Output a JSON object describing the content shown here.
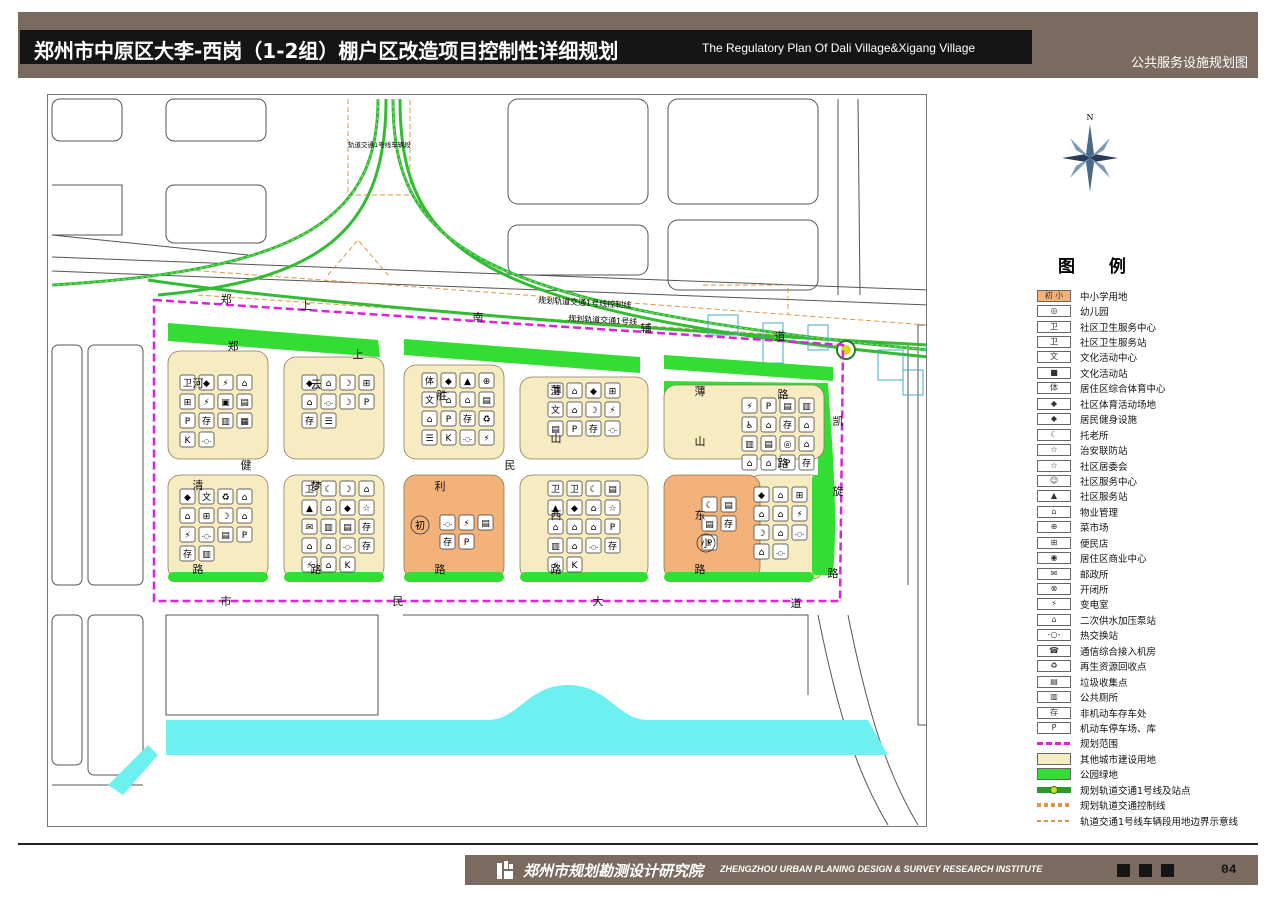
{
  "header": {
    "title_cn": "郑州市中原区大李-西岗（1-2组）棚户区改造项目控制性详细规划",
    "title_en": "The Regulatory Plan Of Dali Village&Xigang Village",
    "sheet_name": "公共服务设施规划图"
  },
  "compass": {
    "north_label": "N"
  },
  "map": {
    "rail_labels": {
      "depot": "轨道交通1号线车辆段",
      "control_line": "规划轨道交通1号线控制线",
      "line": "规划轨道交通1号线"
    },
    "road_labels": [
      {
        "text": "郑"
      },
      {
        "text": "上"
      },
      {
        "text": "南"
      },
      {
        "text": "辅"
      },
      {
        "text": "道"
      },
      {
        "text": "郑"
      },
      {
        "text": "上"
      },
      {
        "text": "路"
      },
      {
        "text": "河"
      },
      {
        "text": "云"
      },
      {
        "text": "胜"
      },
      {
        "text": "薄"
      },
      {
        "text": "山"
      },
      {
        "text": "薄"
      },
      {
        "text": "山"
      },
      {
        "text": "凯"
      },
      {
        "text": "健"
      },
      {
        "text": "民"
      },
      {
        "text": "路"
      },
      {
        "text": "清"
      },
      {
        "text": "梦"
      },
      {
        "text": "利"
      },
      {
        "text": "西"
      },
      {
        "text": "东"
      },
      {
        "text": "旋"
      },
      {
        "text": "路"
      },
      {
        "text": "路"
      },
      {
        "text": "路"
      },
      {
        "text": "路"
      },
      {
        "text": "路"
      },
      {
        "text": "路"
      },
      {
        "text": "市"
      },
      {
        "text": "民"
      },
      {
        "text": "大"
      },
      {
        "text": "道"
      }
    ],
    "school_labels": {
      "primary": "小",
      "junior": "初"
    },
    "blocks": [
      {
        "icons": [
          "卫",
          "◆",
          "⚡",
          "⌂",
          "⊞",
          "⚡",
          "▣",
          "▤",
          "P",
          "存",
          "▥",
          "▦",
          "K",
          "-○-"
        ]
      },
      {
        "icons": [
          "◆",
          "⌂",
          "☽",
          "⊞",
          "⌂",
          "-○-",
          "☽",
          "P",
          "存",
          "☰"
        ]
      },
      {
        "icons": [
          "体",
          "◆",
          "▲",
          "⊕",
          "文",
          "⌂",
          "⌂",
          "▤",
          "⌂",
          "P",
          "存",
          "♻",
          "☰",
          "K",
          "-○-",
          "⚡"
        ]
      },
      {
        "icons": [
          "卫",
          "⌂",
          "◆",
          "⊞",
          "文",
          "⌂",
          "☽",
          "⚡",
          "▤",
          "P",
          "存",
          "-○-"
        ]
      },
      {
        "icons": [
          "⚡",
          "P",
          "▤",
          "▥",
          "♿",
          "⌂",
          "存",
          "⌂",
          "▥",
          "▤",
          "◎",
          "⌂",
          "⌂",
          "⌂",
          "P",
          "存"
        ]
      },
      {
        "icons": [
          "◆",
          "文",
          "♻",
          "⌂",
          "⌂",
          "⊞",
          "☽",
          "⌂",
          "⚡",
          "-○-",
          "▤",
          "P",
          "存",
          "▥"
        ]
      },
      {
        "icons": [
          "卫",
          "☾",
          "☽",
          "⌂",
          "▲",
          "⌂",
          "◆",
          "☆",
          "✉",
          "▥",
          "▤",
          "存",
          "⌂",
          "⌂",
          "-○-",
          "存",
          "⚡",
          "⌂",
          "K"
        ]
      },
      {
        "icons": [
          "-○-",
          "⚡",
          "▤",
          "存",
          "P"
        ]
      },
      {
        "icons": [
          "卫",
          "卫",
          "☾",
          "▤",
          "▲",
          "◆",
          "⌂",
          "☆",
          "⌂",
          "⌂",
          "⌂",
          "P",
          "▥",
          "⌂",
          "-○-",
          "存",
          "⚡",
          "K"
        ]
      },
      {
        "icons": [
          "☾",
          "▤",
          "▤",
          "存",
          "P"
        ]
      },
      {
        "icons": [
          "◆",
          "⌂",
          "⊞",
          "⌂",
          "⌂",
          "⚡",
          "☽",
          "⌂",
          "-○-",
          "⌂",
          "-○-"
        ]
      }
    ]
  },
  "legend": {
    "title": "图 例",
    "items": [
      {
        "label": "中小学用地",
        "icon": "初 小",
        "color": "#f2b27a"
      },
      {
        "label": "幼儿园",
        "icon": "◎"
      },
      {
        "label": "社区卫生服务中心",
        "icon": "卫"
      },
      {
        "label": "社区卫生服务站",
        "icon": "卫"
      },
      {
        "label": "文化活动中心",
        "icon": "文"
      },
      {
        "label": "文化活动站",
        "icon": "■"
      },
      {
        "label": "居住区综合体育中心",
        "icon": "体"
      },
      {
        "label": "社区体育活动场地",
        "icon": "◆"
      },
      {
        "label": "居民健身设施",
        "icon": "◆"
      },
      {
        "label": "托老所",
        "icon": "☾"
      },
      {
        "label": "治安联防站",
        "icon": "☆"
      },
      {
        "label": "社区居委会",
        "icon": "☆"
      },
      {
        "label": "社区服务中心",
        "icon": "☺"
      },
      {
        "label": "社区服务站",
        "icon": "▲"
      },
      {
        "label": "物业管理",
        "icon": "⌂"
      },
      {
        "label": "菜市场",
        "icon": "⊕"
      },
      {
        "label": "便民店",
        "icon": "⊞"
      },
      {
        "label": "居住区商业中心",
        "icon": "◉"
      },
      {
        "label": "邮政所",
        "icon": "✉"
      },
      {
        "label": "开闭所",
        "icon": "⊗"
      },
      {
        "label": "变电室",
        "icon": "⚡"
      },
      {
        "label": "二次供水加压泵站",
        "icon": "⌂"
      },
      {
        "label": "热交换站",
        "icon": "-○-"
      },
      {
        "label": "通信综合接入机房",
        "icon": "☎"
      },
      {
        "label": "再生资源回收点",
        "icon": "♻"
      },
      {
        "label": "垃圾收集点",
        "icon": "▤"
      },
      {
        "label": "公共厕所",
        "icon": "▥"
      },
      {
        "label": "非机动车存车处",
        "icon": "存"
      },
      {
        "label": "机动车停车场、库",
        "icon": "P"
      },
      {
        "label": "规划范围",
        "icon": "",
        "color": "#ffffff"
      },
      {
        "label": "其他城市建设用地",
        "icon": "",
        "color": "#f7ebc1"
      },
      {
        "label": "公园绿地",
        "icon": "",
        "color": "#33dd33"
      },
      {
        "label": "规划轨道交通1号线及站点",
        "icon": "",
        "color": "#ffffff"
      },
      {
        "label": "规划轨道交通控制线",
        "icon": "",
        "color": "#ffffff"
      },
      {
        "label": "轨道交通1号线车辆段用地边界示意线",
        "icon": "",
        "color": "#ffffff"
      }
    ]
  },
  "footer": {
    "institute_cn": "郑州市规划勘测设计研究院",
    "institute_en": "ZHENGZHOU URBAN PLANING DESIGN & SURVEY RESEARCH INSTITUTE",
    "page": "04"
  },
  "colors": {
    "header_band": "#7b6a5f",
    "residential": "#f7ebc1",
    "school": "#f2b27a",
    "green": "#33dd33",
    "boundary": "#dd22dd",
    "rail": "#33bb33",
    "rail_control": "#e0944a",
    "water": "#6ff0f0"
  }
}
